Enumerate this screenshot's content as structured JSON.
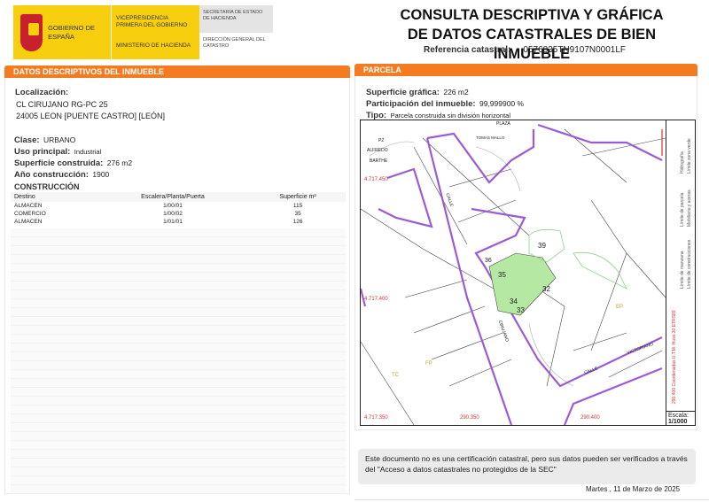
{
  "header": {
    "gov": "GOBIERNO DE ESPAÑA",
    "vice": "VICEPRESIDENCIA PRIMERA DEL GOBIERNO",
    "ministerio": "MINISTERIO DE HACIENDA",
    "secretaria": "SECRETARÍA DE ESTADO DE HACIENDA",
    "direccion": "DIRECCIÓN GENERAL DEL CATASTRO",
    "title1": "CONSULTA DESCRIPTIVA Y GRÁFICA",
    "title2": "DE DATOS CATASTRALES DE BIEN INMUEBLE",
    "ref_label": "Referencia catastral:",
    "ref_value": "0576835TN9107N0001LF"
  },
  "left": {
    "bar": "DATOS DESCRIPTIVOS DEL INMUEBLE",
    "loc_label": "Localización:",
    "loc1": "CL CIRUJANO RG-PC 25",
    "loc2": "24005 LEON [PUENTE CASTRO] [LEÓN]",
    "clase_label": "Clase:",
    "clase": "URBANO",
    "uso_label": "Uso principal:",
    "uso": "Industrial",
    "sup_label": "Superficie construida:",
    "sup": "276 m2",
    "anio_label": "Año construcción:",
    "anio": "1900",
    "constr_title": "CONSTRUCCIÓN",
    "columns": [
      "Destino",
      "Escalera/Planta/Puerta",
      "Superficie m²"
    ],
    "rows": [
      [
        "ALMACEN",
        "1/00/01",
        "115"
      ],
      [
        "COMERCIO",
        "1/00/02",
        "35"
      ],
      [
        "ALMACEN",
        "1/01/01",
        "126"
      ]
    ]
  },
  "right": {
    "bar": "PARCELA",
    "supg_label": "Superficie gráfica:",
    "supg": "226 m2",
    "part_label": "Participación del inmueble:",
    "part": "99,999900 %",
    "tipo_label": "Tipo:",
    "tipo": "Parcela construida sin división horizontal"
  },
  "map": {
    "labels": {
      "plaza": "PLAZA",
      "tomas": "TOMAS MALLO",
      "pz": "PZ",
      "alfredo": "ALFREDO",
      "barthe": "BARTHE",
      "calle": "CALLE",
      "cirujano": "CIRUJANO",
      "calle2": "CALLE",
      "victoriano": "VICTORIANO",
      "p35": "35",
      "p39": "39",
      "p32": "32",
      "p34": "34",
      "p33": "33",
      "p36": "36",
      "ep": "EP",
      "tc": "TC",
      "fp": "FP"
    },
    "coords": {
      "y1": "4.717.450",
      "y2": "4.717.400",
      "y3": "4.717.350",
      "x1": "290.350",
      "x2": "290.400"
    },
    "legend": {
      "l1": "Límite de manzana",
      "l2": "Límite de construcciones",
      "l3": "Límite de parcela",
      "l4": "Mobiliario y aceras",
      "l5": "Hidrografía",
      "l6": "Límite zona verde",
      "utm": "290.400 Coordenadas U.T.M. Huso 30 ETRS89"
    },
    "scale_label": "Escala:",
    "scale": "1/1000"
  },
  "note": "Este documento no es una certificación catastral, pero sus datos pueden ser verificados a través del \"Acceso a datos catastrales no protegidos de la SEC\"",
  "date": "Martes , 11 de Marzo de 2025"
}
